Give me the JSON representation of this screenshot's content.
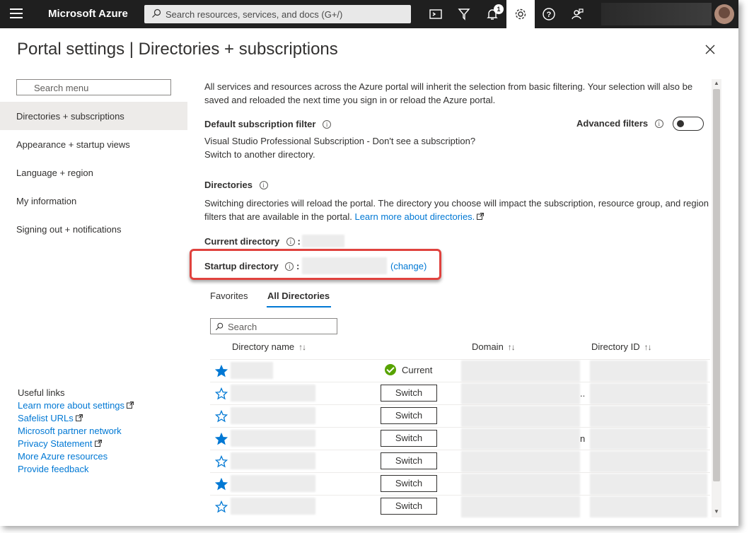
{
  "topbar": {
    "brand": "Microsoft Azure",
    "search_placeholder": "Search resources, services, and docs (G+/)",
    "notification_count": "1",
    "bg_color": "#1f1f1f"
  },
  "title": {
    "main": "Portal settings",
    "separator": "|",
    "sub": "Directories + subscriptions"
  },
  "menu": {
    "search_placeholder": "Search menu",
    "items": [
      {
        "label": "Directories + subscriptions",
        "selected": true
      },
      {
        "label": "Appearance + startup views"
      },
      {
        "label": "Language + region"
      },
      {
        "label": "My information"
      },
      {
        "label": "Signing out + notifications"
      }
    ],
    "useful_links_title": "Useful links",
    "useful_links": [
      {
        "label": "Learn more about settings",
        "external": true
      },
      {
        "label": "Safelist URLs",
        "external": true
      },
      {
        "label": "Microsoft partner network"
      },
      {
        "label": "Privacy Statement",
        "external": true
      },
      {
        "label": "More Azure resources"
      },
      {
        "label": "Provide feedback"
      }
    ]
  },
  "content": {
    "intro_line1": "All services and resources across the Azure portal will inherit the selection from basic filtering. Your selection will also be",
    "intro_line2": "saved and reloaded the next time you sign in or reload the Azure portal.",
    "default_filter_label": "Default subscription filter",
    "advanced_filters_label": "Advanced filters",
    "subscription_line": "Visual Studio Professional Subscription - Don't see a subscription?",
    "switch_dir_line": "Switch to another directory.",
    "directories_label": "Directories",
    "directories_desc1": "Switching directories will reload the portal. The directory you choose will impact the subscription, resource group, and region",
    "directories_desc2": "filters that are available in the portal.",
    "learn_more_link": "Learn more about directories.",
    "current_directory_label": "Current directory",
    "startup_directory_label": "Startup directory",
    "colon": ":",
    "change_link": "(change)",
    "tabs": [
      {
        "label": "Favorites"
      },
      {
        "label": "All Directories",
        "active": true
      }
    ],
    "dir_search_placeholder": "Search",
    "columns": [
      {
        "label": "Directory name",
        "sort": "↑↓"
      },
      {
        "label": "Domain",
        "sort": "↑↓"
      },
      {
        "label": "Directory ID",
        "sort": "↑↓"
      }
    ],
    "rows": [
      {
        "favorite": true,
        "action": "Current"
      },
      {
        "favorite": false,
        "action": "Switch",
        "domain_suffix": ".."
      },
      {
        "favorite": false,
        "action": "Switch"
      },
      {
        "favorite": true,
        "action": "Switch",
        "domain_suffix": "n"
      },
      {
        "favorite": false,
        "action": "Switch"
      },
      {
        "favorite": true,
        "action": "Switch"
      },
      {
        "favorite": false,
        "action": "Switch"
      }
    ],
    "accent_color": "#0078d4",
    "highlight_color": "#e0423e"
  }
}
